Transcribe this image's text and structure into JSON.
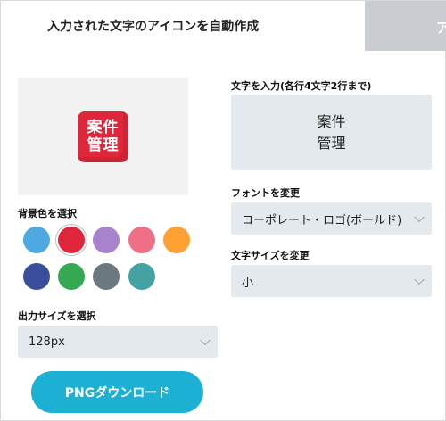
{
  "tabs": {
    "active_label": "入力された文字のアイコンを自動作成",
    "inactive_label": "ア"
  },
  "preview": {
    "icon_line1": "案件",
    "icon_line2": "管理",
    "icon_color": "#e0263a"
  },
  "background": {
    "label": "背景色を選択",
    "swatches": [
      {
        "name": "light-blue",
        "color": "#4fa9e1"
      },
      {
        "name": "red",
        "color": "#e0263a",
        "selected": true
      },
      {
        "name": "purple",
        "color": "#a882cc"
      },
      {
        "name": "pink",
        "color": "#ee6f86"
      },
      {
        "name": "orange",
        "color": "#ffa132"
      },
      {
        "name": "navy",
        "color": "#3a4f9c"
      },
      {
        "name": "green",
        "color": "#35a952"
      },
      {
        "name": "slate-gray",
        "color": "#6b7880"
      },
      {
        "name": "teal",
        "color": "#42a3a2"
      }
    ]
  },
  "output_size": {
    "label": "出力サイズを選択",
    "value": "128px"
  },
  "download_button": "PNGダウンロード",
  "text_input": {
    "label": "文字を入力(各行4文字2行まで)",
    "line1": "案件",
    "line2": "管理"
  },
  "font": {
    "label": "フォントを変更",
    "value": "コーポレート・ロゴ(ボールド)"
  },
  "font_size": {
    "label": "文字サイズを変更",
    "value": "小"
  },
  "colors": {
    "accent": "#1cb0d3",
    "input_bg": "#e3e9ec",
    "tab_inactive_bg": "#c9ccd0"
  }
}
